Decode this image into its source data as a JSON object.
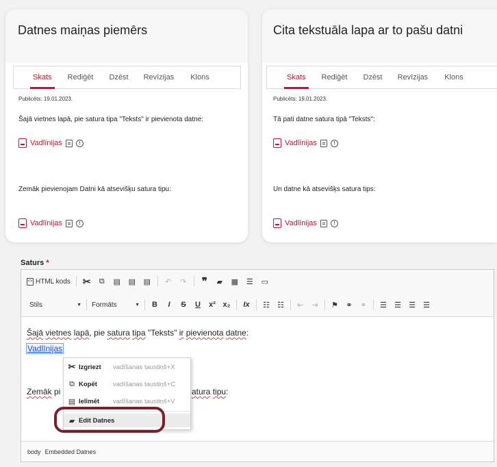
{
  "cards": [
    {
      "title": "Datnes maiņas piemērs",
      "tabs": [
        "Skats",
        "Rediģēt",
        "Dzēst",
        "Revīzijas",
        "Klons"
      ],
      "published": "Publicēts: 19.01.2023.",
      "text1": "Šajā vietnes lapā, pie satura tipa \"Teksts\" ir pievienota datne:",
      "file1": "Vadlīnijas",
      "text2": "Zemāk pievienojam Datni kā atsevišķu satura tipu:",
      "file2": "Vadlīnijas"
    },
    {
      "title": "Cita tekstuāla lapa ar to pašu datni",
      "tabs": [
        "Skats",
        "Rediģēt",
        "Dzēst",
        "Revīzijas",
        "Klons"
      ],
      "published": "Publicēts: 19.01.2023.",
      "text1": "Tā pati datne satura tipā \"Teksts\":",
      "file1": "Vadlīnijas",
      "text2": "Un datne kā atsevišķs satura tips:",
      "file2": "Vadlīnijas"
    }
  ],
  "editor": {
    "label": "Saturs",
    "required_mark": "*",
    "html_btn": "HTML kods",
    "style_combo": "Stils",
    "format_combo": "Formāts",
    "content": {
      "l1_a": "Šajā",
      "l1_b": " ",
      "l1_c": "vietnes",
      "l1_d": " ",
      "l1_e": "lapā",
      "l1_f": ", pie ",
      "l1_g": "satura",
      "l1_h": " ",
      "l1_i": "tipa",
      "l1_j": " \"Teksts\" ",
      "l1_k": "ir",
      "l1_l": " ",
      "l1_m": "pievienota",
      "l1_n": " ",
      "l1_o": "datne",
      "l1_p": ":",
      "link": "Vadlīnijas",
      "l3_a": "Zemāk",
      "l3_b": " pi",
      "l3_c": "atura",
      "l3_d": " ",
      "l3_e": "tipu",
      "l3_f": ":"
    },
    "status": [
      "body",
      "Embedded Datnes"
    ]
  },
  "context_menu": [
    {
      "label": "Izgriezt",
      "shortcut": "vadīšanas taustiņš+X",
      "icon": "scissors-icon"
    },
    {
      "label": "Kopēt",
      "shortcut": "vadīšanas taustiņš+C",
      "icon": "copy-icon"
    },
    {
      "label": "Ielīmēt",
      "shortcut": "vadīšanas taustiņš+V",
      "icon": "paste-icon"
    },
    {
      "label": "Edit Datnes",
      "shortcut": "",
      "icon": "folder-icon"
    }
  ],
  "colors": {
    "accent": "#c8102e",
    "highlight_ring": "#7a1f2d",
    "link": "#1a4fd6"
  }
}
